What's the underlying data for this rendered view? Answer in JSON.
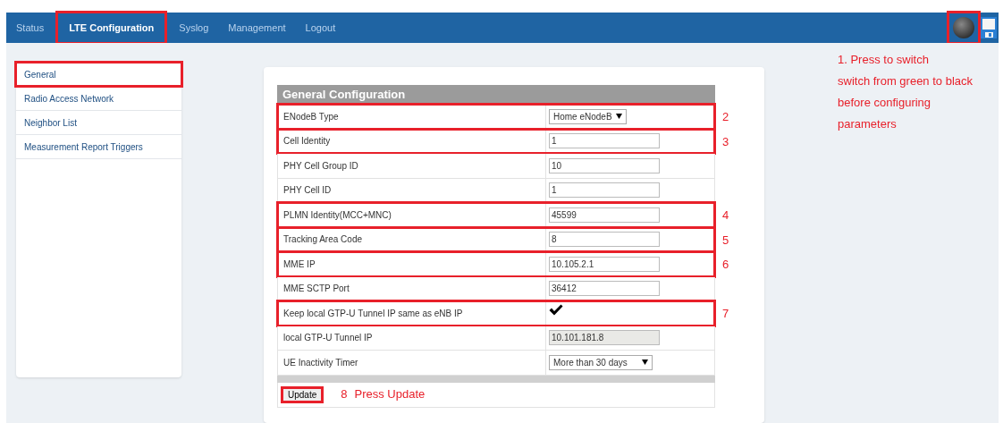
{
  "nav": {
    "tabs": [
      {
        "label": "Status",
        "selected": false,
        "annotated": false
      },
      {
        "label": "LTE Configuration",
        "selected": true,
        "annotated": true
      },
      {
        "label": "Syslog",
        "selected": false,
        "annotated": false
      },
      {
        "label": "Management",
        "selected": false,
        "annotated": false
      },
      {
        "label": "Logout",
        "selected": false,
        "annotated": false
      }
    ],
    "switch": {
      "on": false,
      "annotated": true
    }
  },
  "note": "1. Press to switch\nswitch from green to black\nbefore configuring\nparameters",
  "sidebar": {
    "items": [
      {
        "label": "General",
        "annotated": true
      },
      {
        "label": "Radio Access Network",
        "annotated": false
      },
      {
        "label": "Neighbor List",
        "annotated": false
      },
      {
        "label": "Measurement Report Triggers",
        "annotated": false
      }
    ]
  },
  "form": {
    "title": "General Configuration",
    "rows": [
      {
        "kind": "select",
        "label": "ENodeB Type",
        "value": "Home eNodeB",
        "marker": "2"
      },
      {
        "kind": "input",
        "label": "Cell Identity",
        "value": "1",
        "marker": "3"
      },
      {
        "kind": "input",
        "label": "PHY Cell Group ID",
        "value": "10"
      },
      {
        "kind": "input",
        "label": "PHY Cell ID",
        "value": "1"
      },
      {
        "kind": "input",
        "label": "PLMN Identity(MCC+MNC)",
        "value": "45599",
        "marker": "4"
      },
      {
        "kind": "input",
        "label": "Tracking Area Code",
        "value": "8",
        "marker": "5"
      },
      {
        "kind": "input",
        "label": "MME IP",
        "value": "10.105.2.1",
        "marker": "6"
      },
      {
        "kind": "input",
        "label": "MME SCTP Port",
        "value": "36412"
      },
      {
        "kind": "checkbox",
        "label": "Keep local GTP-U Tunnel IP same as eNB IP",
        "checked": true,
        "marker": "7"
      },
      {
        "kind": "input",
        "label": "local GTP-U Tunnel IP",
        "value": "10.101.181.8",
        "disabled": true
      },
      {
        "kind": "wideselect",
        "label": "UE Inactivity Timer",
        "value": "More than 30 days"
      }
    ],
    "update": {
      "label": "Update",
      "marker": "8",
      "note": "Press Update"
    }
  }
}
